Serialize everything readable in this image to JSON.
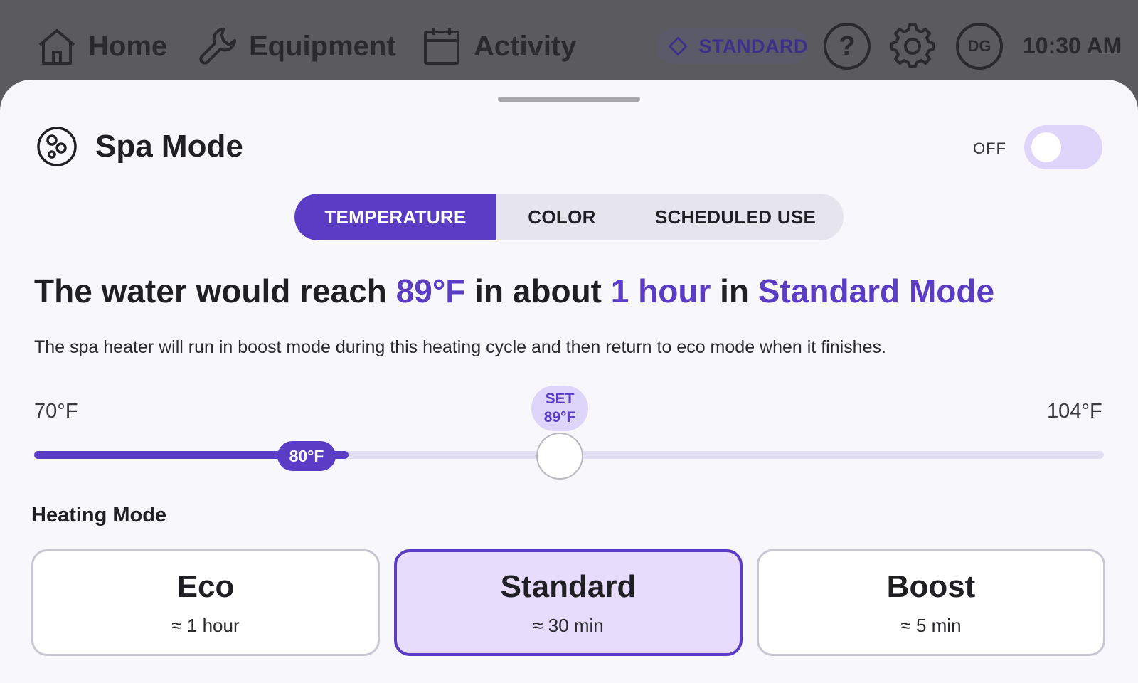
{
  "nav": {
    "home": "Home",
    "equipment": "Equipment",
    "activity": "Activity"
  },
  "status": {
    "mode_badge": "STANDARD",
    "help": "?",
    "avatar_initials": "DG",
    "time": "10:30 AM"
  },
  "panel": {
    "title": "Spa Mode",
    "toggle_label": "OFF",
    "toggle_on": false
  },
  "tabs": [
    {
      "label": "TEMPERATURE",
      "active": true
    },
    {
      "label": "COLOR",
      "active": false
    },
    {
      "label": "SCHEDULED USE",
      "active": false
    }
  ],
  "headline": {
    "p1": "The water would reach ",
    "temp": "89°F",
    "p2": " in about ",
    "duration": "1 hour",
    "p3": " in ",
    "mode": "Standard Mode"
  },
  "description": "The spa heater will run in boost mode during this heating cycle and then return to eco mode when it finishes.",
  "slider": {
    "min_label": "70°F",
    "max_label": "104°F",
    "min": 70,
    "max": 104,
    "current": 80,
    "current_label": "80°F",
    "set": 89,
    "set_label_top": "SET",
    "set_label_value": "89°F"
  },
  "heating": {
    "label": "Heating Mode",
    "modes": [
      {
        "name": "Eco",
        "time": "≈ 1 hour",
        "selected": false
      },
      {
        "name": "Standard",
        "time": "≈ 30 min",
        "selected": true
      },
      {
        "name": "Boost",
        "time": "≈ 5 min",
        "selected": false
      }
    ]
  },
  "colors": {
    "accent": "#5b3cc4",
    "accent_light": "#ddd5fa",
    "selected_card": "#e7dcfb",
    "overlay": "#5b5b5f",
    "sheet": "#f8f7fc"
  }
}
